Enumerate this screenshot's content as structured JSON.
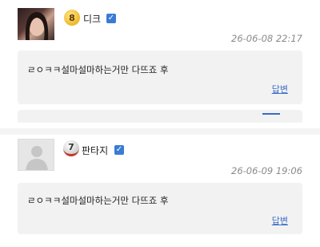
{
  "comments": [
    {
      "level": "8",
      "nickname": "디크",
      "verified_icon": "verified-check-icon",
      "timestamp": "26-06-08 22:17",
      "text": "ㄹㅇㅋㅋ설마설마하는거만 다뜨죠 후",
      "reply_label": "답변",
      "avatar": "profile-photo"
    },
    {
      "level": "7",
      "nickname": "판타지",
      "verified_icon": "verified-check-icon",
      "timestamp": "26-06-09 19:06",
      "text": "ㄹㅇㅋㅋ설마설마하는거만 다뜨죠 후",
      "reply_label": "답변",
      "avatar": "default-user-icon"
    }
  ],
  "colors": {
    "link": "#3a6bc5",
    "verified": "#3a7bd5",
    "timestamp": "#8a8a8a",
    "content_bg": "#f2f2f2"
  }
}
